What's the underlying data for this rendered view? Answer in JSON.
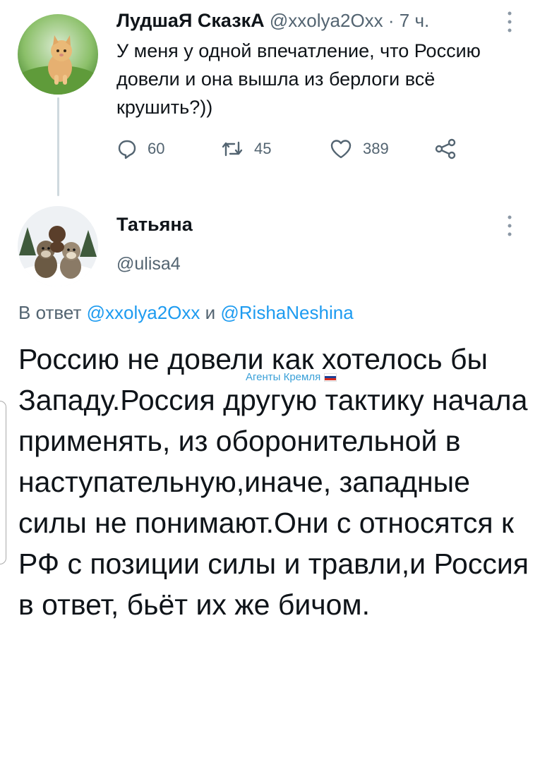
{
  "tweet1": {
    "display_name": "ЛудшаЯ СказкА",
    "handle": "@xxolya2Oxx",
    "separator": " · ",
    "time": "7 ч.",
    "text": "У меня у одной впечатление, что Россию довели и она вышла из берлоги всё крушить?))",
    "avatar_icon": "kitten-avatar",
    "actions": {
      "replies": "60",
      "retweets": "45",
      "likes": "389"
    }
  },
  "tweet2": {
    "display_name": "Татьяна",
    "handle": "@ulisa4",
    "avatar_icon": "dogs-avatar",
    "reply_prefix": "В ответ ",
    "reply_user1": "@xxolya2Oxx",
    "reply_and": " и ",
    "reply_user2": "@RishaNeshina",
    "text": "Россию не довели как хотелось бы Западу.Россия другую тактику начала применять, из оборонительной в наступательную,иначе, западные силы не понимают.Они с относятся к РФ с позиции силы и травли,и Россия в ответ, бьёт их же бичом."
  },
  "watermark": {
    "text": "Агенты Кремля",
    "flag_icon": "russia-flag-icon"
  },
  "colors": {
    "text": "#0f1419",
    "muted": "#536471",
    "link": "#1d9bf0",
    "thread_line": "#cfd9de"
  }
}
